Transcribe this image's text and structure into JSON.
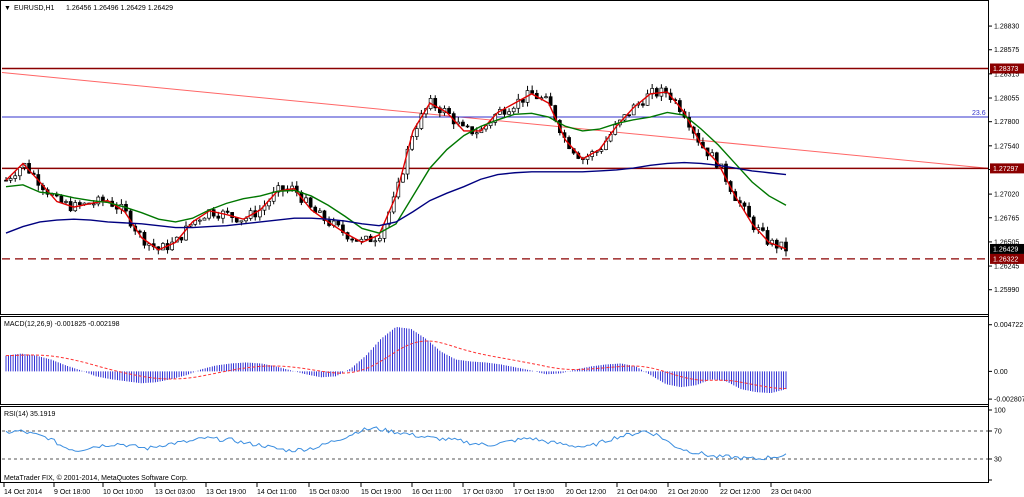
{
  "chart_data": [
    {
      "type": "candlestick",
      "header": {
        "symbol_label": "EURUSD,H1",
        "ohlc_text": "1.26456 1.26496 1.26429 1.26429",
        "arrow_glyph": "▼"
      },
      "price_axis": {
        "min": 1.2575,
        "max": 1.2896,
        "ticks": [
          "1.28830",
          "1.28575",
          "1.28315",
          "1.28055",
          "1.27800",
          "1.27540",
          "1.27285",
          "1.27020",
          "1.26765",
          "1.26505",
          "1.26245",
          "1.25990"
        ]
      },
      "price_labels": [
        {
          "value": 1.28373,
          "text": "1.28373",
          "color": "#8b0000",
          "text_color": "#ffffff"
        },
        {
          "value": 1.27297,
          "text": "1.27297",
          "color": "#8b0000",
          "text_color": "#ffffff"
        },
        {
          "value": 1.26429,
          "text": "1.26429",
          "color": "#000000",
          "text_color": "#ffffff"
        },
        {
          "value": 1.26322,
          "text": "1.26322",
          "color": "#8b0000",
          "text_color": "#ffffff"
        }
      ],
      "horizontal_lines": [
        {
          "value": 1.28373,
          "color": "#8b0000",
          "style": "solid"
        },
        {
          "value": 1.27297,
          "color": "#8b0000",
          "style": "solid"
        },
        {
          "value": 1.26322,
          "color": "#8b0000",
          "style": "dashed"
        }
      ],
      "fibonacci": {
        "value": 1.2785,
        "label": "23.6",
        "color": "#3333cc"
      },
      "trendline": {
        "from": 1.2833,
        "to": 1.273,
        "color": "#ff6666"
      },
      "x_ticks": [
        "14 Oct 2014",
        "9 Oct 18:00",
        "10 Oct 10:00",
        "13 Oct 03:00",
        "13 Oct 19:00",
        "14 Oct 11:00",
        "15 Oct 03:00",
        "15 Oct 19:00",
        "16 Oct 11:00",
        "17 Oct 03:00",
        "17 Oct 19:00",
        "20 Oct 12:00",
        "21 Oct 04:00",
        "21 Oct 20:00",
        "22 Oct 12:00",
        "23 Oct 04:00"
      ],
      "moving_averages": [
        {
          "color": "#e00000",
          "points": [
            1.2717,
            1.2735,
            1.2715,
            1.2694,
            1.2688,
            1.2692,
            1.2695,
            1.2683,
            1.2655,
            1.2642,
            1.265,
            1.2672,
            1.2684,
            1.268,
            1.2675,
            1.2685,
            1.2705,
            1.2708,
            1.2685,
            1.2672,
            1.266,
            1.265,
            1.2658,
            1.27,
            1.277,
            1.28,
            1.279,
            1.277,
            1.277,
            1.279,
            1.28,
            1.281,
            1.28,
            1.276,
            1.274,
            1.275,
            1.2775,
            1.2795,
            1.281,
            1.2812,
            1.279,
            1.2755,
            1.2735,
            1.27,
            1.267,
            1.265,
            1.2643
          ]
        },
        {
          "color": "#007700",
          "points": [
            1.271,
            1.2712,
            1.2704,
            1.2702,
            1.2698,
            1.2695,
            1.2693,
            1.2688,
            1.2682,
            1.2675,
            1.2672,
            1.2676,
            1.2685,
            1.2692,
            1.2697,
            1.27,
            1.2705,
            1.2706,
            1.27,
            1.269,
            1.2678,
            1.2665,
            1.266,
            1.267,
            1.27,
            1.273,
            1.275,
            1.2765,
            1.2775,
            1.2782,
            1.2788,
            1.2789,
            1.2785,
            1.2775,
            1.277,
            1.2772,
            1.2778,
            1.2782,
            1.2785,
            1.279,
            1.2787,
            1.2772,
            1.2755,
            1.2735,
            1.2715,
            1.27,
            1.269
          ]
        },
        {
          "color": "#000080",
          "points": [
            1.266,
            1.2667,
            1.2672,
            1.2674,
            1.2675,
            1.2674,
            1.2672,
            1.2671,
            1.267,
            1.2668,
            1.2666,
            1.2666,
            1.2667,
            1.2668,
            1.267,
            1.2672,
            1.2674,
            1.2676,
            1.2676,
            1.2675,
            1.2673,
            1.267,
            1.2668,
            1.2672,
            1.2683,
            1.2695,
            1.2703,
            1.271,
            1.2718,
            1.2723,
            1.2725,
            1.2726,
            1.2726,
            1.2726,
            1.2726,
            1.2727,
            1.2728,
            1.273,
            1.2733,
            1.2735,
            1.2736,
            1.2735,
            1.2733,
            1.273,
            1.2727,
            1.2725,
            1.2723
          ]
        }
      ]
    },
    {
      "type": "bar",
      "label": "MACD(12,26,9) -0.001825 -0.002198",
      "ticks": [
        "0.004722",
        "0.00",
        "-0.002807"
      ],
      "range": [
        -0.0031,
        0.0052
      ],
      "histogram": [
        0.0016,
        0.0018,
        0.0016,
        0.0012,
        0.0006,
        0.0001,
        -0.0005,
        -0.0008,
        -0.001,
        -0.0012,
        -0.0011,
        -0.0008,
        -0.0004,
        0.0002,
        0.0006,
        0.0008,
        0.0009,
        0.0008,
        0.0005,
        0.0001,
        -0.0003,
        -0.0006,
        -0.0005,
        0.0003,
        0.0016,
        0.0033,
        0.0045,
        0.0043,
        0.0033,
        0.002,
        0.0012,
        0.001,
        0.0009,
        0.0007,
        0.0004,
        0.0001,
        -0.0003,
        -0.0002,
        0.0002,
        0.0005,
        0.0007,
        0.0008,
        0.0005,
        -0.0004,
        -0.0013,
        -0.0016,
        -0.0014,
        -0.0008,
        -0.001,
        -0.0018,
        -0.0021,
        -0.0022,
        -0.0018
      ],
      "signal_color": "#ff3333",
      "bar_color": "#0000cc"
    },
    {
      "type": "line",
      "label": "RSI(14) 35.1919",
      "ticks": [
        "100",
        "70",
        "30",
        "0"
      ],
      "levels": [
        70,
        30
      ],
      "color": "#3b8ee0",
      "values": [
        68,
        70,
        65,
        60,
        48,
        42,
        47,
        50,
        52,
        48,
        45,
        50,
        53,
        55,
        60,
        58,
        57,
        52,
        50,
        45,
        42,
        44,
        47,
        55,
        62,
        71,
        74,
        70,
        67,
        63,
        60,
        58,
        56,
        52,
        50,
        53,
        57,
        60,
        55,
        52,
        49,
        47,
        54,
        61,
        65,
        70,
        64,
        50,
        42,
        38,
        33,
        33,
        31,
        30,
        33,
        35
      ]
    }
  ],
  "copyright": "MetaTrader FIX, © 2001-2014, MetaQuotes Software Corp."
}
